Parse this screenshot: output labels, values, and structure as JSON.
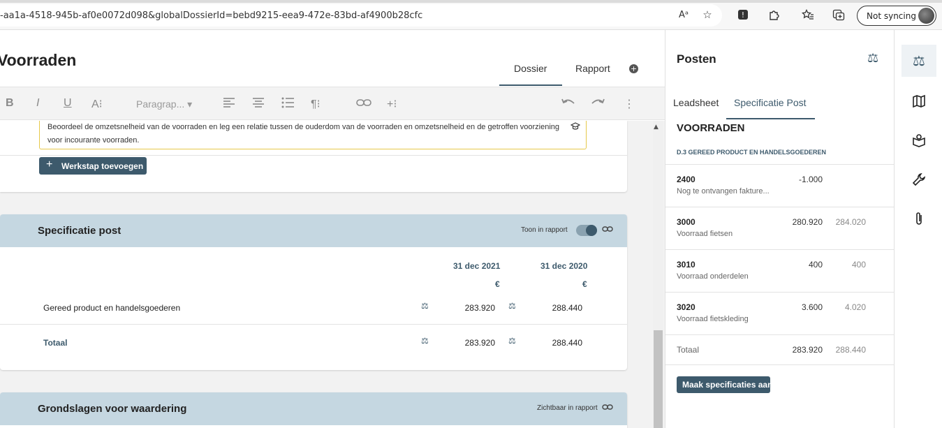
{
  "browser": {
    "url": "-aa1a-4518-945b-af0e0072d098&globalDossierId=bebd9215-eea9-472e-83bd-af4900b28cfc",
    "read_aloud_icon": "Aᵃ",
    "sync_label": "Not syncing"
  },
  "main": {
    "title": "Voorraden",
    "tabs": [
      {
        "label": "Dossier"
      },
      {
        "label": "Rapport"
      }
    ],
    "add_icon": "+",
    "toolbar": {
      "bold": "B",
      "italic": "I",
      "underline": "U",
      "text_size": "A⁝",
      "paragraph": "Paragrap...",
      "paragraph_caret": "▾",
      "pilcrow": "¶⁝",
      "insert": "+⁝",
      "more": "⋮"
    },
    "instruction_text": "Beoordeel de omzetsnelheid van de voorraden en leg een relatie tussen de ouderdom van de voorraden en omzetsnelheid en de getroffen voorziening voor incourante voorraden.",
    "add_step_button": "Werkstap toevoegen",
    "specificatie": {
      "title": "Specificatie post",
      "toggle_label": "Toon in rapport",
      "col1_header": "31 dec 2021",
      "col2_header": "31 dec 2020",
      "currency": "€",
      "rows": [
        {
          "label": "Gereed product en handelsgoederen",
          "v2021": "283.920",
          "v2020": "288.440"
        }
      ],
      "total": {
        "label": "Totaal",
        "v2021": "283.920",
        "v2020": "288.440"
      }
    },
    "grondslagen": {
      "title": "Grondslagen voor waardering",
      "visible_label": "Zichtbaar in rapport"
    }
  },
  "panel": {
    "title": "Posten",
    "tabs": [
      {
        "label": "Leadsheet"
      },
      {
        "label": "Specificatie Post"
      }
    ],
    "heading": "VOORRADEN",
    "subheading": "D.3 GEREED PRODUCT EN HANDELSGOEDEREN",
    "accounts": [
      {
        "number": "2400",
        "desc": "Nog te ontvangen fakture...",
        "current": "-1.000",
        "previous": ""
      },
      {
        "number": "3000",
        "desc": "Voorraad fietsen",
        "current": "280.920",
        "previous": "284.020"
      },
      {
        "number": "3010",
        "desc": "Voorraad onderdelen",
        "current": "400",
        "previous": "400"
      },
      {
        "number": "3020",
        "desc": "Voorraad fietskleding",
        "current": "3.600",
        "previous": "4.020"
      }
    ],
    "total": {
      "label": "Totaal",
      "current": "283.920",
      "previous": "288.440"
    },
    "create_button": "Maak specificaties aan"
  },
  "rail": {
    "items": [
      "scale-icon",
      "map-icon",
      "book-icon",
      "wrench-icon",
      "paperclip-icon"
    ]
  },
  "colors": {
    "accent": "#3d5a6c",
    "section_header": "#c5d7e1",
    "warning_border": "#e6c94a"
  }
}
